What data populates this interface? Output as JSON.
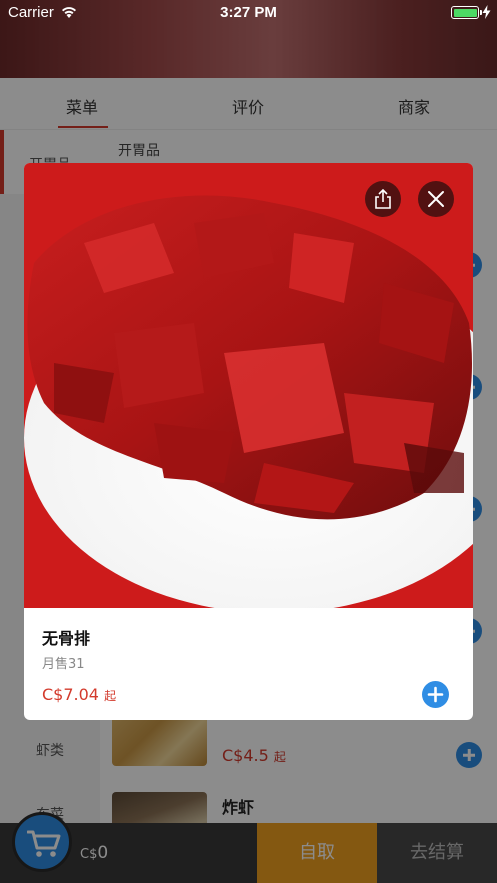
{
  "status_bar": {
    "carrier": "Carrier",
    "time": "3:27 PM"
  },
  "tabs": [
    {
      "label": "菜单"
    },
    {
      "label": "评价"
    },
    {
      "label": "商家"
    }
  ],
  "sidebar": {
    "items": [
      {
        "label": "开胃品"
      },
      {
        "label": "虾类"
      },
      {
        "label": "东菜"
      }
    ]
  },
  "menu": {
    "section_title": "开胃品",
    "visible_items": [
      {
        "name": "",
        "currency": "C$",
        "price": "4.5",
        "suffix": "起"
      },
      {
        "name": "炸虾"
      }
    ]
  },
  "modal": {
    "dish_name": "无骨排",
    "monthly_sales": "月售31",
    "currency": "C$",
    "price": "7.04",
    "price_suffix": "起"
  },
  "bottom_bar": {
    "currency": "C$",
    "cart_total": "0",
    "pickup_label": "自取",
    "checkout_label": "去结算"
  },
  "colors": {
    "accent": "#d33a2c",
    "primary_blue": "#2f8de4",
    "pickup_orange": "#f0a020"
  }
}
